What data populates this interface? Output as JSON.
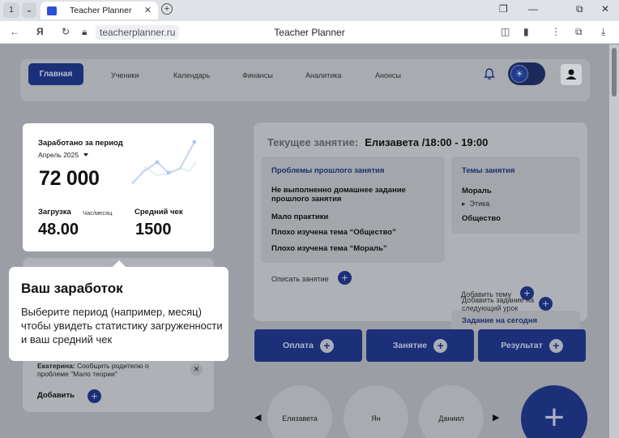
{
  "browser": {
    "tab_title": "Teacher Planner",
    "url": "teacherplanner.ru",
    "page_title": "Teacher Planner"
  },
  "nav": {
    "home": "Главная",
    "links": [
      "Ученики",
      "Календарь",
      "Финансы",
      "Аналитика",
      "Анонсы"
    ]
  },
  "earnings": {
    "title": "Заработано за период",
    "period": "Апрель 2025",
    "value": "72 000",
    "load_label": "Загрузка",
    "load_unit": "Час/месяц",
    "load_value": "48.00",
    "avg_label": "Средний чек",
    "avg_value": "1500"
  },
  "tooltip": {
    "title": "Ваш заработок",
    "text": "Выберите период (например, месяц) чтобы увидеть статистику загруженности и ваш средний чек"
  },
  "lesson": {
    "current_label": "Текущее занятие:",
    "current_value": "Елизавета /18:00 - 19:00",
    "problems_title": "Проблемы прошлого занятия",
    "problems": [
      "Не выполненно домашнее задание прошлого занятия",
      "Мало практики",
      "Плохо изучена тема “Общество”",
      "Плохо изучена тема “Мораль”"
    ],
    "describe": "Описать занятие",
    "topics_title": "Темы занятия",
    "topic1": "Мораль",
    "topic1_sub": "Этика",
    "topic2": "Общество",
    "add_topic": "Добавить тему",
    "tasks_title": "Задание на сегодня",
    "add_task": "Добавить задание на следующий урок"
  },
  "actions": [
    "Оплата",
    "Занятие",
    "Результат"
  ],
  "students": [
    "Елизавета",
    "Ян",
    "Даниил"
  ],
  "note": {
    "author": "Екатерина:",
    "text": "Сообщить родителю о проблеме \"Мало теории\"",
    "add": "Добавить"
  }
}
